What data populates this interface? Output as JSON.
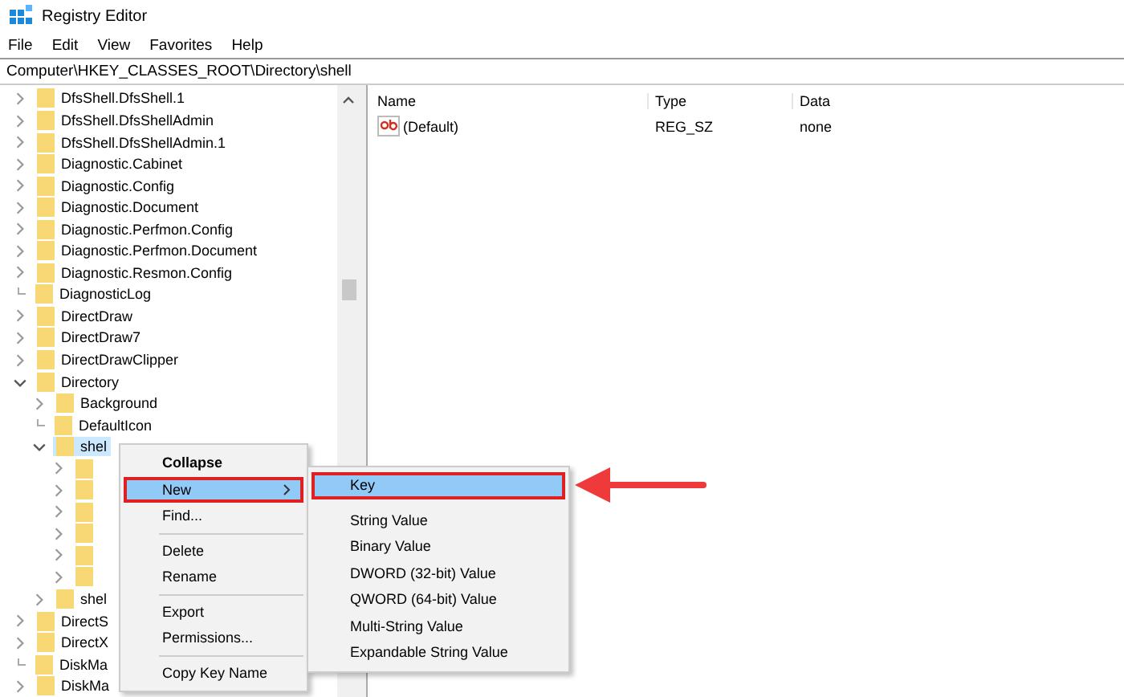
{
  "window": {
    "title": "Registry Editor"
  },
  "menu_bar": [
    "File",
    "Edit",
    "View",
    "Favorites",
    "Help"
  ],
  "address": "Computer\\HKEY_CLASSES_ROOT\\Directory\\shell",
  "tree": [
    {
      "label": "DfsShell.DfsShell.1",
      "kind": "branch",
      "expanded": false,
      "selected": false
    },
    {
      "label": "DfsShell.DfsShellAdmin",
      "kind": "branch",
      "expanded": false,
      "selected": false
    },
    {
      "label": "DfsShell.DfsShellAdmin.1",
      "kind": "branch",
      "expanded": false,
      "selected": false
    },
    {
      "label": "Diagnostic.Cabinet",
      "kind": "branch",
      "expanded": false,
      "selected": false
    },
    {
      "label": "Diagnostic.Config",
      "kind": "branch",
      "expanded": false,
      "selected": false
    },
    {
      "label": "Diagnostic.Document",
      "kind": "branch",
      "expanded": false,
      "selected": false
    },
    {
      "label": "Diagnostic.Perfmon.Config",
      "kind": "branch",
      "expanded": false,
      "selected": false
    },
    {
      "label": "Diagnostic.Perfmon.Document",
      "kind": "branch",
      "expanded": false,
      "selected": false
    },
    {
      "label": "Diagnostic.Resmon.Config",
      "kind": "branch",
      "expanded": false,
      "selected": false
    },
    {
      "label": "DiagnosticLog",
      "kind": "leaf",
      "selected": false
    },
    {
      "label": "DirectDraw",
      "kind": "branch",
      "expanded": false,
      "selected": false
    },
    {
      "label": "DirectDraw7",
      "kind": "branch",
      "expanded": false,
      "selected": false
    },
    {
      "label": "DirectDrawClipper",
      "kind": "branch",
      "expanded": false,
      "selected": false
    },
    {
      "label": "Directory",
      "kind": "branch",
      "expanded": true,
      "selected": false,
      "children": [
        {
          "label": "Background",
          "kind": "branch",
          "expanded": false,
          "selected": false
        },
        {
          "label": "DefaultIcon",
          "kind": "leaf",
          "selected": false
        },
        {
          "label": "shel",
          "kind": "branch",
          "expanded": true,
          "selected": true,
          "children": [
            {
              "kind": "branch",
              "expanded": false,
              "selected": false
            },
            {
              "kind": "branch",
              "expanded": false,
              "selected": false
            },
            {
              "kind": "branch",
              "expanded": false,
              "selected": false
            },
            {
              "kind": "branch",
              "expanded": false,
              "selected": false
            },
            {
              "kind": "branch",
              "expanded": false,
              "selected": false
            },
            {
              "kind": "branch",
              "expanded": false,
              "selected": false
            }
          ]
        },
        {
          "label": "shel",
          "kind": "branch",
          "expanded": false,
          "selected": false
        }
      ]
    },
    {
      "label": "DirectS",
      "kind": "branch",
      "expanded": false,
      "selected": false
    },
    {
      "label": "DirectX",
      "kind": "branch",
      "expanded": false,
      "selected": false
    },
    {
      "label": "DiskMa",
      "kind": "leaf",
      "selected": false
    },
    {
      "label": "DiskMa",
      "kind": "branch",
      "expanded": false,
      "selected": false
    }
  ],
  "values": {
    "columns": [
      "Name",
      "Type",
      "Data"
    ],
    "rows": [
      {
        "name": "(Default)",
        "type": "REG_SZ",
        "data": "none"
      }
    ]
  },
  "context_menu": {
    "groups": [
      [
        {
          "label": "Collapse",
          "default": true,
          "selected": false,
          "submenu": false,
          "outlined": false
        },
        {
          "label": "New",
          "default": false,
          "selected": true,
          "submenu": true,
          "outlined": true
        },
        {
          "label": "Find...",
          "default": false,
          "selected": false,
          "submenu": false,
          "outlined": false
        }
      ],
      [
        {
          "label": "Delete",
          "default": false,
          "selected": false,
          "submenu": false,
          "outlined": false
        },
        {
          "label": "Rename",
          "default": false,
          "selected": false,
          "submenu": false,
          "outlined": false
        }
      ],
      [
        {
          "label": "Export",
          "default": false,
          "selected": false,
          "submenu": false,
          "outlined": false
        },
        {
          "label": "Permissions...",
          "default": false,
          "selected": false,
          "submenu": false,
          "outlined": false
        }
      ],
      [
        {
          "label": "Copy Key Name",
          "default": false,
          "selected": false,
          "submenu": false,
          "outlined": false
        }
      ]
    ]
  },
  "submenu": {
    "groups": [
      [
        {
          "label": "Key",
          "selected": true,
          "outlined": true
        }
      ],
      [
        {
          "label": "String Value",
          "selected": false,
          "outlined": false
        },
        {
          "label": "Binary Value",
          "selected": false,
          "outlined": false
        },
        {
          "label": "DWORD (32-bit) Value",
          "selected": false,
          "outlined": false
        },
        {
          "label": "QWORD (64-bit) Value",
          "selected": false,
          "outlined": false
        },
        {
          "label": "Multi-String Value",
          "selected": false,
          "outlined": false
        },
        {
          "label": "Expandable String Value",
          "selected": false,
          "outlined": false
        }
      ]
    ]
  }
}
